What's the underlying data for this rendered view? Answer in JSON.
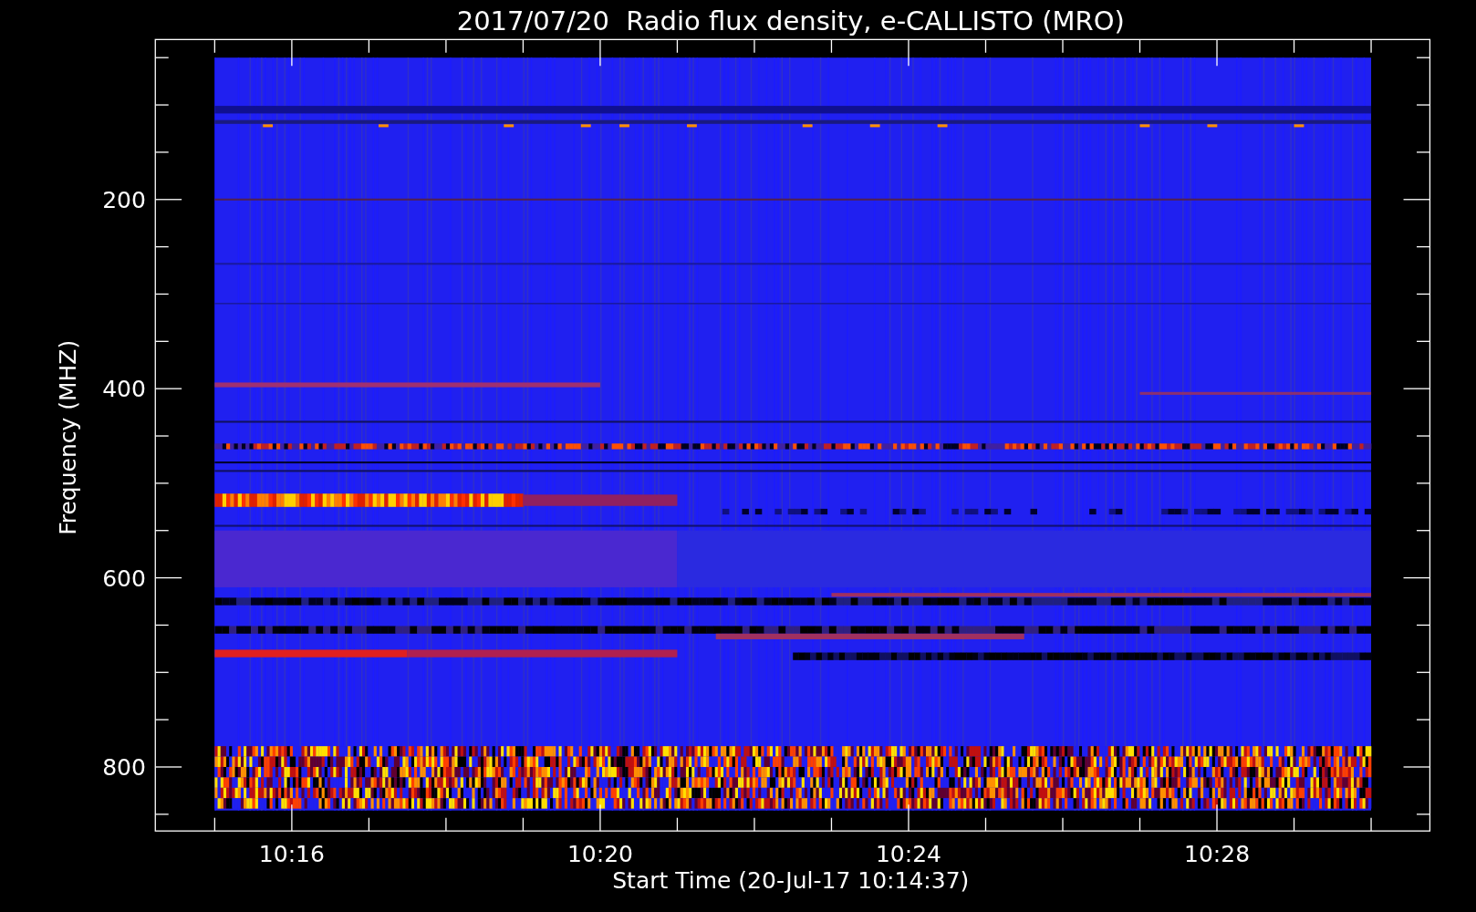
{
  "plot": {
    "title": "2017/07/20  Radio flux density, e-CALLISTO (MRO)",
    "xlabel": "Start Time (20-Jul-17 10:14:37)",
    "ylabel": "Frequency (MHZ)",
    "xtick_labels": [
      "10:16",
      "10:20",
      "10:24",
      "10:28"
    ],
    "ytick_labels": [
      "200",
      "400",
      "600",
      "800"
    ]
  }
}
